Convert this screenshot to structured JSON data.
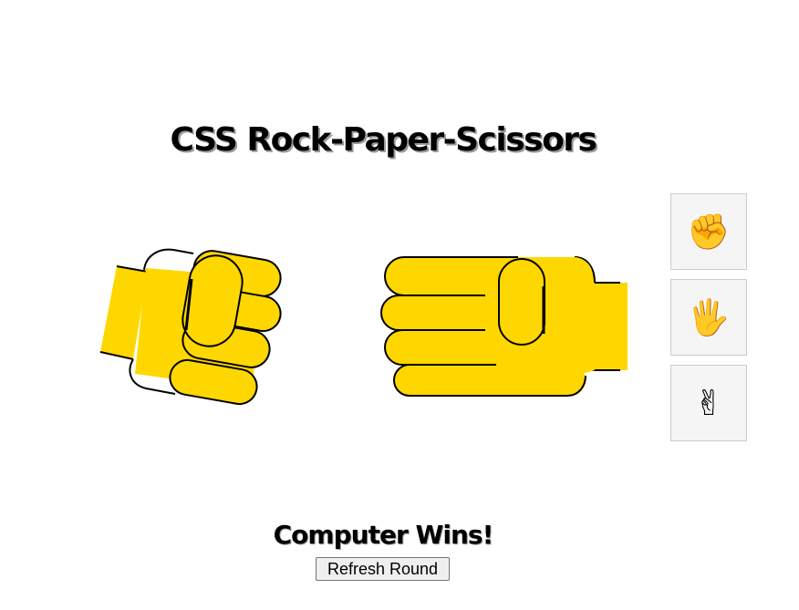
{
  "page": {
    "title": "CSS Rock-Paper-Scissors",
    "result": "Computer Wins!",
    "refresh_label": "Refresh Round"
  },
  "colors": {
    "hand_fill": "#FFD700",
    "hand_stroke": "#000000",
    "choice_bg": "#F5F5F5",
    "choice_border": "#CCCCCC"
  },
  "player_hand": {
    "gesture": "rock",
    "icon": "fist-hand-icon"
  },
  "computer_hand": {
    "gesture": "paper",
    "icon": "open-hand-icon"
  },
  "choices": [
    {
      "name": "rock",
      "emoji": "✊",
      "icon": "raised-fist-icon"
    },
    {
      "name": "paper",
      "emoji": "🖐",
      "icon": "raised-hand-icon"
    },
    {
      "name": "scissors",
      "emoji": "✌",
      "icon": "victory-hand-icon"
    }
  ]
}
